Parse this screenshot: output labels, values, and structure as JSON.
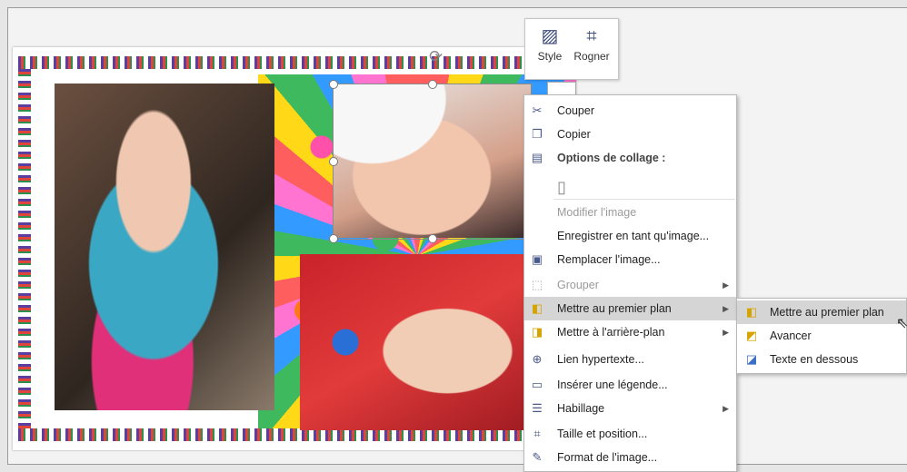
{
  "mini_toolbar": {
    "style_label": "Style",
    "crop_label": "Rogner"
  },
  "context_menu": {
    "items": [
      {
        "label": "Couper",
        "icon": "scissors-icon",
        "state": "enabled"
      },
      {
        "label": "Copier",
        "icon": "copy-icon",
        "state": "enabled"
      },
      {
        "label": "Options de collage :",
        "icon": "paste-icon",
        "state": "header"
      },
      {
        "label": "Modifier l'image",
        "icon": "",
        "state": "disabled"
      },
      {
        "label": "Enregistrer en tant qu'image...",
        "icon": "",
        "state": "enabled"
      },
      {
        "label": "Remplacer l'image...",
        "icon": "replace-image-icon",
        "state": "enabled"
      },
      {
        "label": "Grouper",
        "icon": "group-icon",
        "state": "disabled"
      },
      {
        "label": "Mettre au premier plan",
        "icon": "bring-front-icon",
        "state": "highlighted"
      },
      {
        "label": "Mettre à l'arrière-plan",
        "icon": "send-back-icon",
        "state": "enabled"
      },
      {
        "label": "Lien hypertexte...",
        "icon": "link-icon",
        "state": "enabled"
      },
      {
        "label": "Insérer une légende...",
        "icon": "caption-icon",
        "state": "enabled"
      },
      {
        "label": "Habillage",
        "icon": "wrap-icon",
        "state": "enabled"
      },
      {
        "label": "Taille et position...",
        "icon": "size-position-icon",
        "state": "enabled"
      },
      {
        "label": "Format de l'image...",
        "icon": "format-picture-icon",
        "state": "enabled"
      }
    ]
  },
  "submenu": {
    "items": [
      {
        "label": "Mettre au premier plan",
        "icon": "bring-to-front-icon",
        "state": "highlighted"
      },
      {
        "label": "Avancer",
        "icon": "bring-forward-icon",
        "state": "enabled"
      },
      {
        "label": "Texte en dessous",
        "icon": "behind-text-icon",
        "state": "enabled"
      }
    ]
  }
}
